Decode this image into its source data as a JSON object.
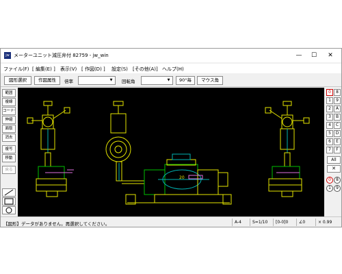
{
  "window": {
    "title": "メーターユニット減圧弁付 82759 - jw_win",
    "app_icon_text": "jw",
    "controls": {
      "minimize": "—",
      "maximize": "☐",
      "close": "✕"
    }
  },
  "menu": [
    "ファイル(F)",
    "[ 編集(E) ]",
    "表示(V)",
    "[ 作図(D) ]",
    "設定(S)",
    "[その他(A)]",
    "ヘルプ(H)"
  ],
  "toolbar": {
    "select_shape": "図形選択",
    "shape_attr": "作図属性",
    "scale_label": "倍率",
    "scale_value": "",
    "rotate_label": "回転角",
    "rotate_value": "",
    "deg90": "90°毎",
    "mouse_angle": "マウス角"
  },
  "left_tools": {
    "range": "範囲",
    "polyline": "複線",
    "corner": "コーナー",
    "stretch": "伸縮",
    "chamfer": "面取",
    "erase": "消去",
    "copy": "複写",
    "move": "移動",
    "undo": "戻る"
  },
  "right_tools": {
    "layer_groups_top": [
      [
        "0",
        "8"
      ],
      [
        "1",
        "9"
      ],
      [
        "2",
        "A"
      ],
      [
        "3",
        "B"
      ],
      [
        "4",
        "C"
      ],
      [
        "5",
        "D"
      ],
      [
        "6",
        "E"
      ],
      [
        "7",
        "F"
      ]
    ],
    "active_top": "0",
    "all": "All",
    "x": "✕",
    "layer_groups_bottom": [
      [
        "0",
        "8"
      ],
      [
        "1",
        "9"
      ]
    ],
    "active_bottom": "0"
  },
  "status": {
    "message": "【図形】データがありません。再選択してください。",
    "paper": "A-4",
    "scale": "S=1/10",
    "layer": "[0-0]0",
    "angle": "∠0",
    "zoom": "× 0.99"
  },
  "drawing_text": {
    "dim_label": "20"
  },
  "colors": {
    "canvas_bg": "#000000",
    "outline_yellow": "#e6e600",
    "outline_green": "#00c000",
    "pipe_cyan": "#00b4b4",
    "hatch_pink": "#e070e0",
    "accent_red": "#d00000"
  }
}
